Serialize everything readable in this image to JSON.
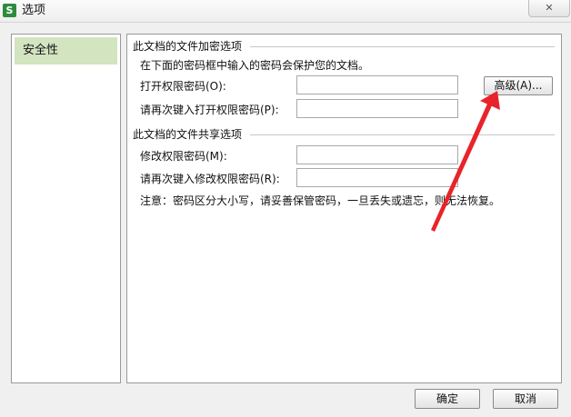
{
  "window": {
    "title": "选项",
    "app_icon": "wps-spreadsheet-icon",
    "close_icon": "close-icon"
  },
  "sidebar": {
    "items": [
      {
        "label": "安全性"
      }
    ]
  },
  "encryption": {
    "section_title": "此文档的文件加密选项",
    "description": "在下面的密码框中输入的密码会保护您的文档。",
    "open_password_label": "打开权限密码(O):",
    "open_password_value": "",
    "confirm_open_label": "请再次键入打开权限密码(P):",
    "confirm_open_value": "",
    "advanced_button": "高级(A)..."
  },
  "sharing": {
    "section_title": "此文档的文件共享选项",
    "modify_password_label": "修改权限密码(M):",
    "modify_password_value": "",
    "confirm_modify_label": "请再次键入修改权限密码(R):",
    "confirm_modify_value": ""
  },
  "note": "注意：密码区分大小写，请妥善保管密码，一旦丢失或遗忘，则无法恢复。",
  "buttons": {
    "ok": "确定",
    "cancel": "取消"
  },
  "colors": {
    "sidebar_selected": "#d3e4c1",
    "annotation_arrow": "#e8242a",
    "app_icon": "#2e8b3d"
  }
}
